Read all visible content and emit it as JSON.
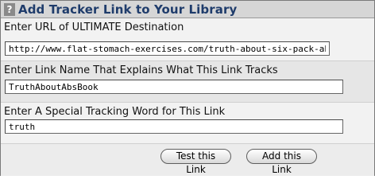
{
  "title": "Add Tracker Link to Your Library",
  "help_icon": "question-mark-icon",
  "fields": {
    "destination": {
      "label": "Enter URL of ULTIMATE Destination",
      "value": "http://www.flat-stomach-exercises.com/truth-about-six-pack-abs.html"
    },
    "link_name": {
      "label": "Enter Link Name That Explains What This Link Tracks",
      "value": "TruthAboutAbsBook"
    },
    "tracking_word": {
      "label": "Enter A Special Tracking Word for This Link",
      "value": "truth"
    }
  },
  "buttons": {
    "test": "Test this Link",
    "add": "Add this Link"
  }
}
